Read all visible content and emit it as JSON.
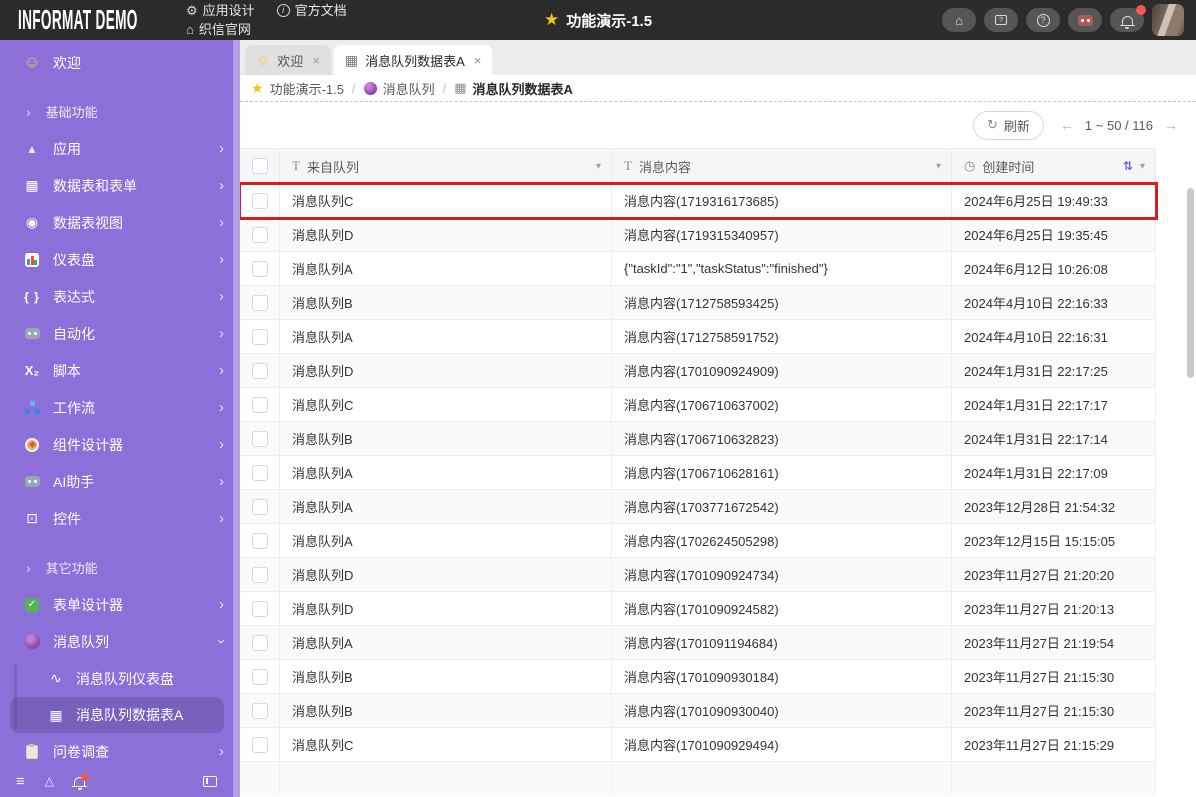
{
  "colors": {
    "topbar_bg": "#2b2b2b",
    "sidebar_purple": "#8c6fd9",
    "accent_sort_purple": "#7b5fd6",
    "highlight_red": "#e0191f",
    "star_yellow": "#f5c518"
  },
  "icons": {
    "gear": "⚙",
    "home": "⌂",
    "info": "i",
    "star": "★",
    "smiley": "☺",
    "table": "▦",
    "view": "◉",
    "mountain": "▲",
    "braces": "{ }",
    "script": "X₂",
    "widget": "⊡",
    "chart_line": "∿",
    "chevron_right": "›",
    "dropdown": "▾",
    "clock": "◷",
    "sort": "⇅",
    "refresh": "↻",
    "prev": "←",
    "next": "→",
    "close": "×",
    "check": "✓",
    "menu": "≡",
    "triangle": "△",
    "text_type": "T",
    "question": "?",
    "slash": "/"
  },
  "topbar": {
    "logo": "INFORMAT DEMO",
    "menu": [
      {
        "label": "应用设计"
      },
      {
        "label": "官方文档"
      },
      {
        "label": "织信官网"
      }
    ],
    "title": "功能演示-1.5"
  },
  "sidebar": {
    "items": [
      {
        "label": "欢迎"
      },
      {
        "label": "基础功能"
      },
      {
        "label": "应用"
      },
      {
        "label": "数据表和表单"
      },
      {
        "label": "数据表视图"
      },
      {
        "label": "仪表盘"
      },
      {
        "label": "表达式"
      },
      {
        "label": "自动化"
      },
      {
        "label": "脚本"
      },
      {
        "label": "工作流"
      },
      {
        "label": "组件设计器"
      },
      {
        "label": "AI助手"
      },
      {
        "label": "控件"
      },
      {
        "label": "其它功能"
      },
      {
        "label": "表单设计器"
      },
      {
        "label": "消息队列"
      },
      {
        "label": "消息队列仪表盘"
      },
      {
        "label": "消息队列数据表A"
      },
      {
        "label": "问卷调查"
      }
    ]
  },
  "tabs": [
    {
      "label": "欢迎",
      "active": false
    },
    {
      "label": "消息队列数据表A",
      "active": true
    }
  ],
  "breadcrumb": [
    {
      "label": "功能演示-1.5"
    },
    {
      "label": "消息队列"
    },
    {
      "label": "消息队列数据表A"
    }
  ],
  "toolbar": {
    "refresh_label": "刷新",
    "pagination": "1 ~ 50 / 116"
  },
  "table": {
    "columns": [
      {
        "label": "来自队列"
      },
      {
        "label": "消息内容"
      },
      {
        "label": "创建时间"
      }
    ],
    "highlight_row": 0,
    "rows": [
      {
        "queue": "消息队列C",
        "content": "消息内容(1719316173685)",
        "time": "2024年6月25日 19:49:33"
      },
      {
        "queue": "消息队列D",
        "content": "消息内容(1719315340957)",
        "time": "2024年6月25日 19:35:45"
      },
      {
        "queue": "消息队列A",
        "content": "{\"taskId\":\"1\",\"taskStatus\":\"finished\"}",
        "time": "2024年6月12日 10:26:08"
      },
      {
        "queue": "消息队列B",
        "content": "消息内容(1712758593425)",
        "time": "2024年4月10日 22:16:33"
      },
      {
        "queue": "消息队列A",
        "content": "消息内容(1712758591752)",
        "time": "2024年4月10日 22:16:31"
      },
      {
        "queue": "消息队列D",
        "content": "消息内容(1701090924909)",
        "time": "2024年1月31日 22:17:25"
      },
      {
        "queue": "消息队列C",
        "content": "消息内容(1706710637002)",
        "time": "2024年1月31日 22:17:17"
      },
      {
        "queue": "消息队列B",
        "content": "消息内容(1706710632823)",
        "time": "2024年1月31日 22:17:14"
      },
      {
        "queue": "消息队列A",
        "content": "消息内容(1706710628161)",
        "time": "2024年1月31日 22:17:09"
      },
      {
        "queue": "消息队列A",
        "content": "消息内容(1703771672542)",
        "time": "2023年12月28日 21:54:32"
      },
      {
        "queue": "消息队列A",
        "content": "消息内容(1702624505298)",
        "time": "2023年12月15日 15:15:05"
      },
      {
        "queue": "消息队列D",
        "content": "消息内容(1701090924734)",
        "time": "2023年11月27日 21:20:20"
      },
      {
        "queue": "消息队列D",
        "content": "消息内容(1701090924582)",
        "time": "2023年11月27日 21:20:13"
      },
      {
        "queue": "消息队列A",
        "content": "消息内容(1701091194684)",
        "time": "2023年11月27日 21:19:54"
      },
      {
        "queue": "消息队列B",
        "content": "消息内容(1701090930184)",
        "time": "2023年11月27日 21:15:30"
      },
      {
        "queue": "消息队列B",
        "content": "消息内容(1701090930040)",
        "time": "2023年11月27日 21:15:30"
      },
      {
        "queue": "消息队列C",
        "content": "消息内容(1701090929494)",
        "time": "2023年11月27日 21:15:29"
      }
    ]
  }
}
